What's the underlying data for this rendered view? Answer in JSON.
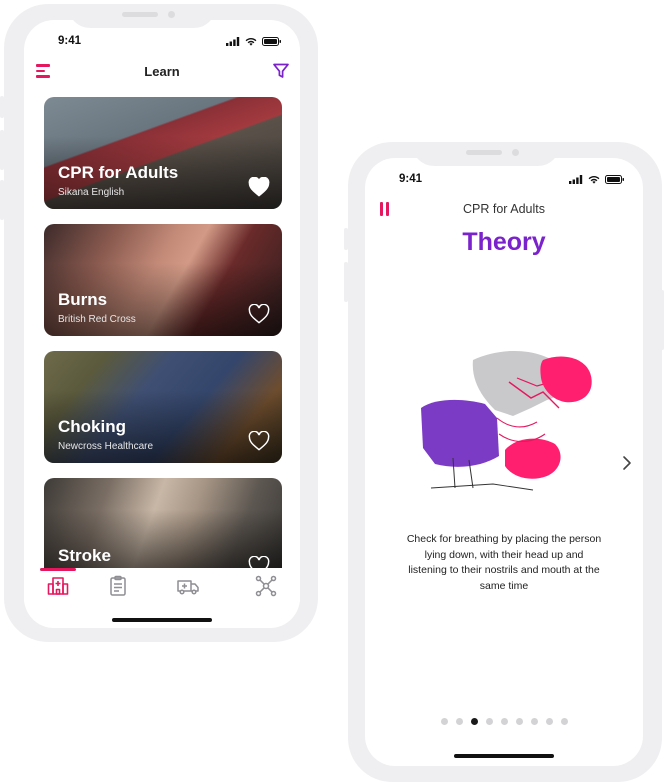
{
  "colors": {
    "accent": "#e5185f",
    "brand_purple": "#7a22cc",
    "frame": "#efeff1"
  },
  "learn_screen": {
    "status_time": "9:41",
    "title": "Learn",
    "cards": [
      {
        "title": "CPR for Adults",
        "subtitle": "Sikana English",
        "favorited": true
      },
      {
        "title": "Burns",
        "subtitle": "British Red Cross",
        "favorited": false
      },
      {
        "title": "Choking",
        "subtitle": "Newcross Healthcare",
        "favorited": false
      },
      {
        "title": "Stroke",
        "subtitle": "",
        "favorited": false
      }
    ],
    "tabs": [
      {
        "icon": "hospital-icon",
        "active": true
      },
      {
        "icon": "clipboard-icon",
        "active": false
      },
      {
        "icon": "ambulance-icon",
        "active": false
      },
      {
        "icon": "network-icon",
        "active": false
      }
    ]
  },
  "lesson_screen": {
    "status_time": "9:41",
    "lesson_title": "CPR for Adults",
    "section_title": "Theory",
    "caption": "Check for breathing by placing the person lying down, with their head up and listening to their nostrils and mouth at the same time",
    "pagination": {
      "total": 9,
      "current": 3
    }
  }
}
